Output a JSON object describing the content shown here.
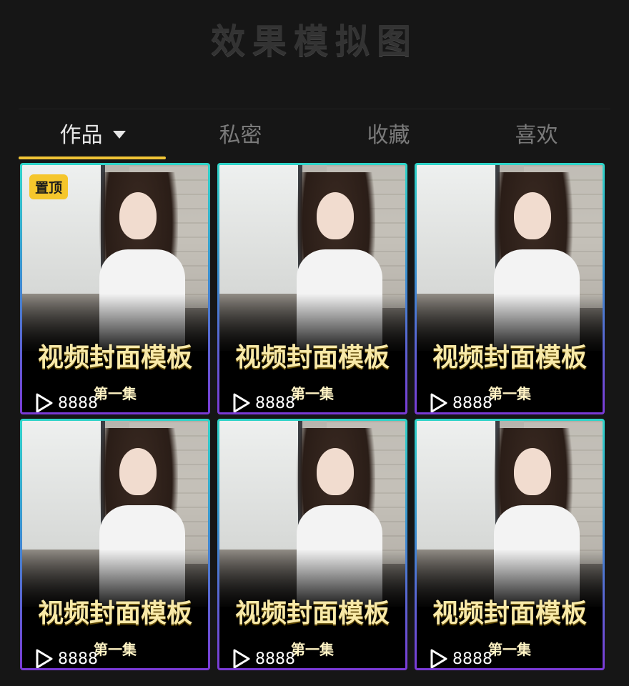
{
  "header": {
    "title": "效果模拟图"
  },
  "tabs": [
    {
      "label": "作品",
      "active": true
    },
    {
      "label": "私密",
      "active": false
    },
    {
      "label": "收藏",
      "active": false
    },
    {
      "label": "喜欢",
      "active": false
    }
  ],
  "cards": [
    {
      "badge": "置顶",
      "title": "视频封面模板",
      "episode": "第一集",
      "views": "8888"
    },
    {
      "badge": "",
      "title": "视频封面模板",
      "episode": "第一集",
      "views": "8888"
    },
    {
      "badge": "",
      "title": "视频封面模板",
      "episode": "第一集",
      "views": "8888"
    },
    {
      "badge": "",
      "title": "视频封面模板",
      "episode": "第一集",
      "views": "8888"
    },
    {
      "badge": "",
      "title": "视频封面模板",
      "episode": "第一集",
      "views": "8888"
    },
    {
      "badge": "",
      "title": "视频封面模板",
      "episode": "第一集",
      "views": "8888"
    }
  ],
  "colors": {
    "accent": "#f0c436",
    "badge_bg": "#f5c62c",
    "border_top": "#2fd4c8",
    "border_bottom": "#7b3ad6"
  },
  "icons": {
    "tab_dropdown": "caret-down-icon",
    "views": "play-icon"
  }
}
